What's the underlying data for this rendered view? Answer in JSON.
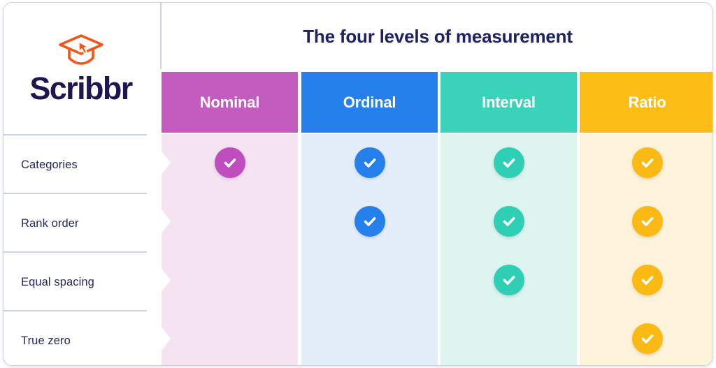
{
  "brand": {
    "name": "Scribbr",
    "logo_icon": "graduation-cap-cursor-icon",
    "logo_color": "#F55418",
    "wordmark_color": "#211551"
  },
  "header": {
    "title": "The four levels of measurement"
  },
  "table": {
    "columns": [
      {
        "label": "Nominal",
        "header_color": "#C45CBF",
        "tint": "#F5E3F2",
        "check_color": "#C04DBE"
      },
      {
        "label": "Ordinal",
        "header_color": "#2680EB",
        "tint": "#E4EDFA",
        "check_color": "#2680EB"
      },
      {
        "label": "Interval",
        "header_color": "#3BD2BA",
        "tint": "#DDF4EF",
        "check_color": "#2FCFB5"
      },
      {
        "label": "Ratio",
        "header_color": "#FCBE15",
        "tint": "#FDF3DA",
        "check_color": "#FBBA13"
      }
    ],
    "rows": [
      {
        "label": "Categories",
        "checks": [
          true,
          true,
          true,
          true
        ]
      },
      {
        "label": "Rank order",
        "checks": [
          false,
          true,
          true,
          true
        ]
      },
      {
        "label": "Equal spacing",
        "checks": [
          false,
          false,
          true,
          true
        ]
      },
      {
        "label": "True zero",
        "checks": [
          false,
          false,
          false,
          true
        ]
      }
    ],
    "check_icon": "check-mark-icon"
  }
}
